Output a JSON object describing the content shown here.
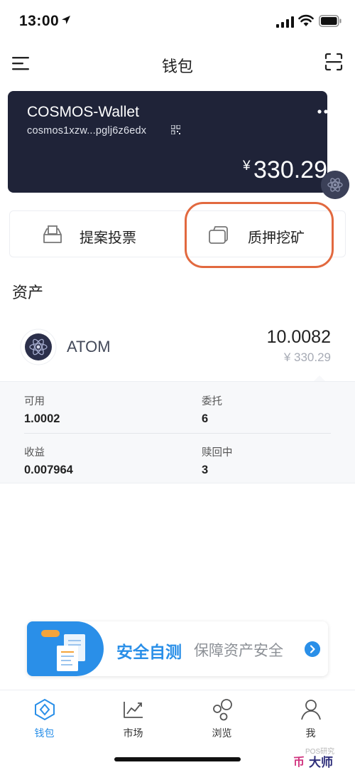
{
  "status_bar": {
    "time": "13:00"
  },
  "nav": {
    "title": "钱包"
  },
  "wallet": {
    "name": "COSMOS-Wallet",
    "address": "cosmos1xzw...pglj6z6edx",
    "currency_symbol": "¥",
    "balance": "330.29"
  },
  "actions": {
    "proposal_label": "提案投票",
    "stake_label": "质押挖矿"
  },
  "assets": {
    "heading": "资产",
    "items": [
      {
        "name": "ATOM",
        "amount": "10.0082",
        "fiat": "¥ 330.29",
        "details": {
          "available_label": "可用",
          "available_value": "1.0002",
          "delegated_label": "委托",
          "delegated_value": "6",
          "rewards_label": "收益",
          "rewards_value": "0.007964",
          "unbonding_label": "赎回中",
          "unbonding_value": "3"
        }
      }
    ]
  },
  "banner": {
    "title": "安全自测",
    "subtitle": "保障资产安全"
  },
  "tab_bar": {
    "tabs": [
      {
        "label": "钱包",
        "icon": "wallet-icon",
        "active": true
      },
      {
        "label": "市场",
        "icon": "market-chart-icon",
        "active": false
      },
      {
        "label": "浏览",
        "icon": "browse-bubbles-icon",
        "active": false
      },
      {
        "label": "我",
        "icon": "profile-icon",
        "active": false
      }
    ]
  },
  "watermark": {
    "source": "POS研究",
    "logo_mark": "币",
    "logo_text": "大师"
  },
  "colors": {
    "accent": "#2a8fe8",
    "card_bg": "#1f2338",
    "highlight": "#e2693f"
  }
}
